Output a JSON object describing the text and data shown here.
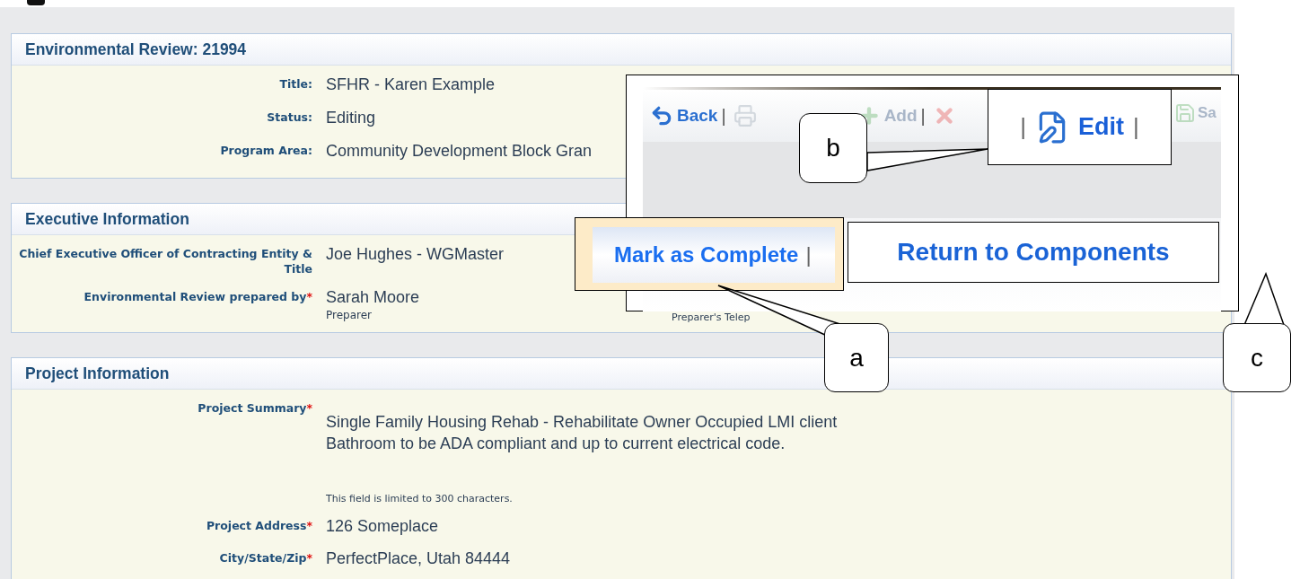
{
  "sections": [
    {
      "title": "Environmental Review: 21994",
      "fields": [
        {
          "label": "Title:",
          "value": "SFHR - Karen Example"
        },
        {
          "label": "Status:",
          "value": "Editing"
        },
        {
          "label": "Program Area:",
          "value": "Community Development Block Gran"
        }
      ]
    },
    {
      "title": "Executive Information",
      "fields": [
        {
          "label": "Chief Executive Officer of Contracting Entity & Title",
          "value": "Joe Hughes - WGMaster"
        },
        {
          "label": "Environmental Review prepared by",
          "required_mark": "*",
          "value": "Sarah Moore",
          "note": "Preparer"
        }
      ]
    },
    {
      "title": "Project Information",
      "fields": [
        {
          "label": "Project Summary",
          "required_mark": "*",
          "value_lines": [
            "Single Family Housing Rehab - Rehabilitate Owner Occupied LMI client",
            "Bathroom to be ADA compliant and up to current electrical code."
          ],
          "hint": "This field is limited to 300 characters."
        },
        {
          "label": "Project Address",
          "required_mark": "*",
          "value": "126 Someplace"
        },
        {
          "label": "City/State/Zip",
          "required_mark": "*",
          "value": "PerfectPlace, Utah 84444"
        }
      ]
    }
  ],
  "hidden_label": "Preparer's Telep",
  "zoom_inset": {
    "toolbar": [
      {
        "kind": "back",
        "label": "Back",
        "disabled": false,
        "separator": "|"
      },
      {
        "kind": "print",
        "disabled": true
      },
      {
        "kind": "add",
        "label": "Add",
        "disabled": true,
        "separator": "|"
      },
      {
        "kind": "delete",
        "disabled": true
      }
    ],
    "edit": {
      "separator_before": "|",
      "label": "Edit",
      "separator_after": "|"
    },
    "save": {
      "kind": "save",
      "label": "Sa",
      "disabled": true
    },
    "mark_complete": {
      "label": "Mark as Complete",
      "separator": "|"
    },
    "return_button": {
      "label": "Return to Components"
    }
  },
  "callouts": [
    {
      "label": "a"
    },
    {
      "label": "b"
    },
    {
      "label": "c"
    }
  ]
}
